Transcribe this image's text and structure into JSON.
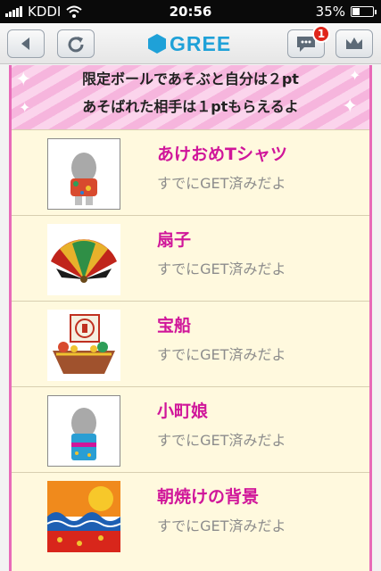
{
  "status": {
    "carrier": "KDDI",
    "time": "20:56",
    "battery": "35%",
    "battery_level": 0.35
  },
  "toolbar": {
    "logo_text": "GREE",
    "notification_count": "1"
  },
  "banner": {
    "line1": "限定ボールであそぶと自分は２pt",
    "line2": "あそばれた相手は１ptもらえるよ"
  },
  "items": [
    {
      "name": "あけおめTシャツ",
      "status": "すでにGET済みだよ",
      "thumb": "avatar-shirt"
    },
    {
      "name": "扇子",
      "status": "すでにGET済みだよ",
      "thumb": "fan"
    },
    {
      "name": "宝船",
      "status": "すでにGET済みだよ",
      "thumb": "treasure-ship"
    },
    {
      "name": "小町娘",
      "status": "すでにGET済みだよ",
      "thumb": "avatar-kimono"
    },
    {
      "name": "朝焼けの背景",
      "status": "すでにGET済みだよ",
      "thumb": "sunrise-background"
    }
  ],
  "colors": {
    "accent": "#d0169a",
    "logo": "#1fa1d8",
    "border": "#e86bb8",
    "row_bg": "#fff9de"
  }
}
